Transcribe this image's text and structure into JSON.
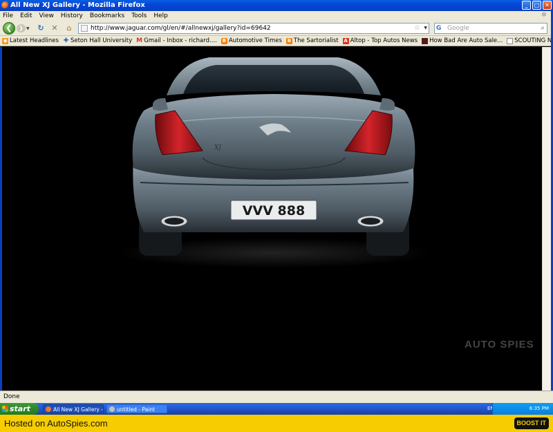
{
  "window": {
    "title": "All New XJ Gallery - Mozilla Firefox"
  },
  "menu": [
    "File",
    "Edit",
    "View",
    "History",
    "Bookmarks",
    "Tools",
    "Help"
  ],
  "nav": {
    "url": "http://www.jaguar.com/gl/en/#/allnewxj/gallery?id=69642",
    "search_placeholder": "Google",
    "search_engine": "G"
  },
  "bookmarks": [
    {
      "label": "Latest Headlines",
      "icon": "rss-icon"
    },
    {
      "label": "Seton Hall University",
      "icon": "seton-icon"
    },
    {
      "label": "Gmail - Inbox - richard....",
      "icon": "gmail-icon"
    },
    {
      "label": "Automotive Times",
      "icon": "blogger-icon"
    },
    {
      "label": "The Sartorialist",
      "icon": "blogger-icon"
    },
    {
      "label": "Altop - Top Autos News",
      "icon": "altop-icon"
    },
    {
      "label": "How Bad Are Auto Sale...",
      "icon": "dark-icon"
    },
    {
      "label": "SCOUTING NY - www.s...",
      "icon": "page-icon"
    }
  ],
  "content": {
    "license_plate": "VVV 888",
    "badge": "XJ"
  },
  "status": "Done",
  "taskbar": {
    "start": "start",
    "tasks": [
      {
        "label": "All New XJ Gallery - M..."
      },
      {
        "label": "untitled - Paint"
      }
    ],
    "lang": "EN",
    "time": "6:35 PM"
  },
  "footer": {
    "text": "Hosted on AutoSpies.com",
    "boost": "BOOST IT",
    "watermark": "AUTO SPIES"
  }
}
